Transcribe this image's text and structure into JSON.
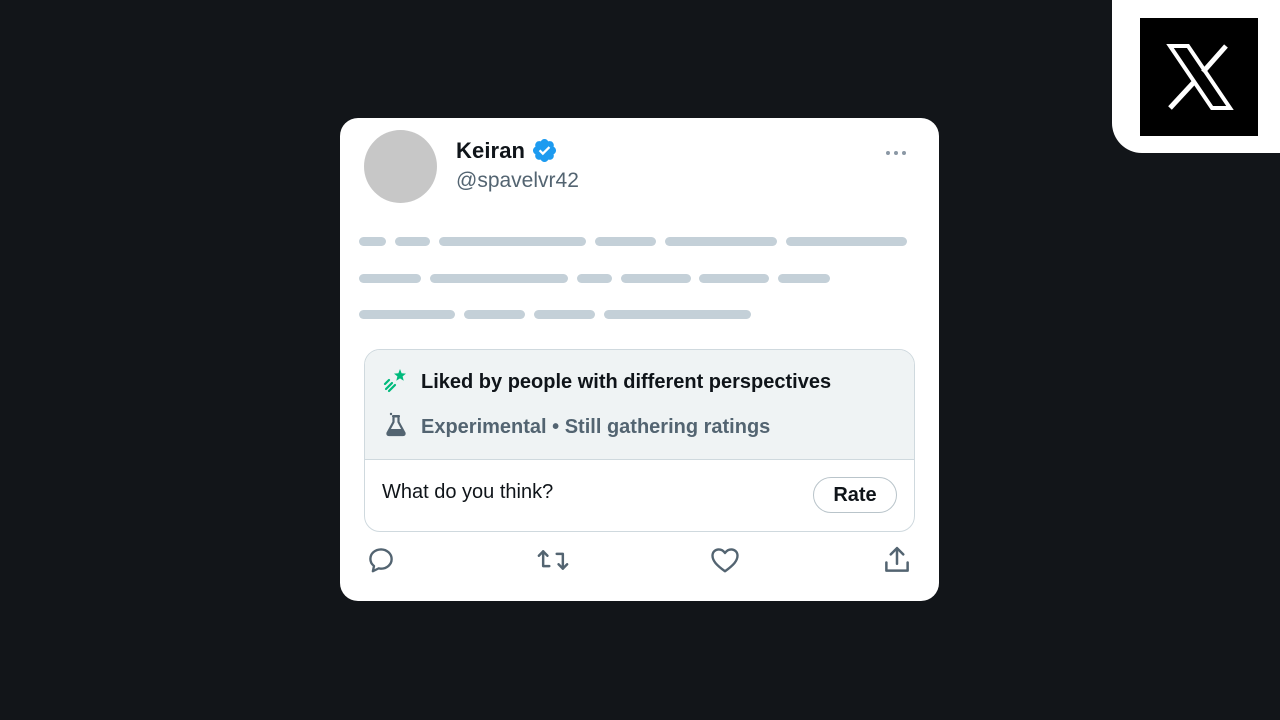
{
  "brand": {
    "logo_icon": "x-logo-icon",
    "logo_bg": "#000000"
  },
  "tweet": {
    "author": {
      "display_name": "Keiran",
      "handle": "@spavelvr42",
      "verified": true,
      "verified_color": "#1d9bf0"
    },
    "more_icon": "more-dots-icon"
  },
  "community_note": {
    "title": "Liked by people with different perspectives",
    "title_icon": "sparkle-stars-icon",
    "status": "Experimental • Still gathering ratings",
    "status_icon": "beaker-icon",
    "prompt": "What do you think?",
    "rate_label": "Rate",
    "accent_color": "#00ba7c"
  },
  "actions": [
    {
      "name": "reply",
      "icon": "reply-icon"
    },
    {
      "name": "retweet",
      "icon": "retweet-icon"
    },
    {
      "name": "like",
      "icon": "heart-icon"
    },
    {
      "name": "share",
      "icon": "share-icon"
    }
  ]
}
